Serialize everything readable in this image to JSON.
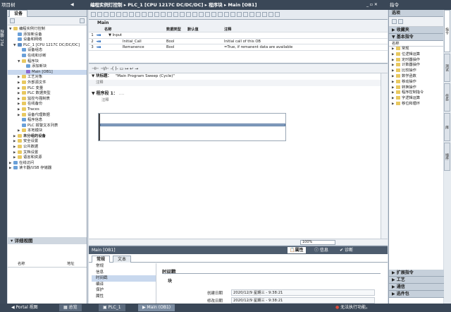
{
  "breadcrumb": [
    "编程实例灯控制",
    "PLC_1 [CPU 1217C DC/DC/DC]",
    "程序块",
    "Main [OB1]"
  ],
  "project_tree": {
    "title": "项目树",
    "vtab": "PLC 编程",
    "devices_tab": "设备",
    "items": [
      {
        "label": "编程实例灯控制",
        "level": 0,
        "tri": "▼",
        "color": "#e8c860"
      },
      {
        "label": "添加新设备",
        "level": 1,
        "tri": "",
        "color": "#6aa0d8"
      },
      {
        "label": "设备和网络",
        "level": 1,
        "tri": "",
        "color": "#6aa0d8"
      },
      {
        "label": "PLC_1 [CPU 1217C DC/DC/DC]",
        "level": 1,
        "tri": "▼",
        "color": "#5a8ac0"
      },
      {
        "label": "设备组态",
        "level": 2,
        "tri": "",
        "color": "#6aa0d8"
      },
      {
        "label": "在线和诊断",
        "level": 2,
        "tri": "",
        "color": "#6aa0d8"
      },
      {
        "label": "程序块",
        "level": 2,
        "tri": "▼",
        "color": "#e8c860"
      },
      {
        "label": "添加新块",
        "level": 3,
        "tri": "",
        "color": "#6aa0d8"
      },
      {
        "label": "Main [OB1]",
        "level": 3,
        "tri": "",
        "color": "#8a6ad0",
        "selected": true
      },
      {
        "label": "工艺对象",
        "level": 2,
        "tri": "▶",
        "color": "#e8c860"
      },
      {
        "label": "外部源文件",
        "level": 2,
        "tri": "▶",
        "color": "#e8c860"
      },
      {
        "label": "PLC 变量",
        "level": 2,
        "tri": "▶",
        "color": "#e8c860"
      },
      {
        "label": "PLC 数据类型",
        "level": 2,
        "tri": "▶",
        "color": "#e8c860"
      },
      {
        "label": "监控与强制表",
        "level": 2,
        "tri": "▶",
        "color": "#e8c860"
      },
      {
        "label": "在线备份",
        "level": 2,
        "tri": "▶",
        "color": "#e8c860"
      },
      {
        "label": "Traces",
        "level": 2,
        "tri": "▶",
        "color": "#e8c860"
      },
      {
        "label": "设备代理数据",
        "level": 2,
        "tri": "▶",
        "color": "#e8c860"
      },
      {
        "label": "程序信息",
        "level": 2,
        "tri": "",
        "color": "#6aa0d8"
      },
      {
        "label": "PLC 报警文本列表",
        "level": 2,
        "tri": "",
        "color": "#6aa0d8"
      },
      {
        "label": "本地模块",
        "level": 2,
        "tri": "▶",
        "color": "#e8c860"
      },
      {
        "label": "未分组的设备",
        "level": 1,
        "tri": "▶",
        "color": "#e8c860",
        "bold": true
      },
      {
        "label": "安全设置",
        "level": 1,
        "tri": "▶",
        "color": "#e8c860"
      },
      {
        "label": "公共数据",
        "level": 1,
        "tri": "▶",
        "color": "#e8c860"
      },
      {
        "label": "文档设置",
        "level": 1,
        "tri": "▶",
        "color": "#e8c860"
      },
      {
        "label": "语言和资源",
        "level": 1,
        "tri": "▶",
        "color": "#e8c860"
      },
      {
        "label": "在线访问",
        "level": 0,
        "tri": "▶",
        "color": "#6aa0d8"
      },
      {
        "label": "读卡器/USB 存储器",
        "level": 0,
        "tri": "▶",
        "color": "#6aa0d8"
      }
    ]
  },
  "details_view": {
    "title": "详细视图",
    "col_name": "名称",
    "col_addr": "地址"
  },
  "editor": {
    "block_title": "Main",
    "columns": [
      "名称",
      "数据类型",
      "默认值",
      "注释"
    ],
    "rows": [
      {
        "num": "1",
        "name": "▼ Input",
        "type": "",
        "default": "",
        "comment": ""
      },
      {
        "num": "2",
        "name": "Initial_Call",
        "type": "Bool",
        "default": "",
        "comment": "Initial call of this OB"
      },
      {
        "num": "3",
        "name": "Remanence",
        "type": "Bool",
        "default": "",
        "comment": "=True, if remanent data are available"
      }
    ],
    "block_header_label": "块标题：",
    "block_header_value": "\"Main Program Sweep (Cycle)\"",
    "comment_label": "注释",
    "network_label": "程序段 1：",
    "network_dots": "....",
    "zoom": "100%"
  },
  "inspector": {
    "title": "Main [OB1]",
    "props_tab": "属性",
    "info_tab": "信息",
    "diag_tab": "诊断",
    "tabs": [
      "常规",
      "文本"
    ],
    "left_items": [
      "常规",
      "信息",
      "时间戳",
      "编译",
      "保护",
      "属性"
    ],
    "section": "时间戳",
    "sub": "块",
    "created_label": "创建日期",
    "created_value": "2020/12/9 星期三 - 9:38:21",
    "modified_label": "修改日期",
    "modified_value": "2020/12/9 星期三 - 9:38:21"
  },
  "tasks": {
    "title": "指令",
    "options": "选项",
    "favorites": "收藏夹",
    "basic": "基本指令",
    "name_col": "名称",
    "items": [
      "常规",
      "位逻辑运算",
      "定时器操作",
      "计数器操作",
      "比较操作",
      "数学函数",
      "移动操作",
      "转换操作",
      "程序控制指令",
      "字逻辑运算",
      "移位和循环"
    ],
    "bottom": [
      "扩展指令",
      "工艺",
      "通信",
      "选件包"
    ],
    "side_tabs": [
      "指令",
      "测试",
      "任务",
      "库",
      "插件"
    ]
  },
  "taskbar": {
    "portal": "Portal 视图",
    "overview": "总览",
    "plc": "PLC_1",
    "main": "Main (OB1)",
    "status": "无法执行功能。"
  }
}
